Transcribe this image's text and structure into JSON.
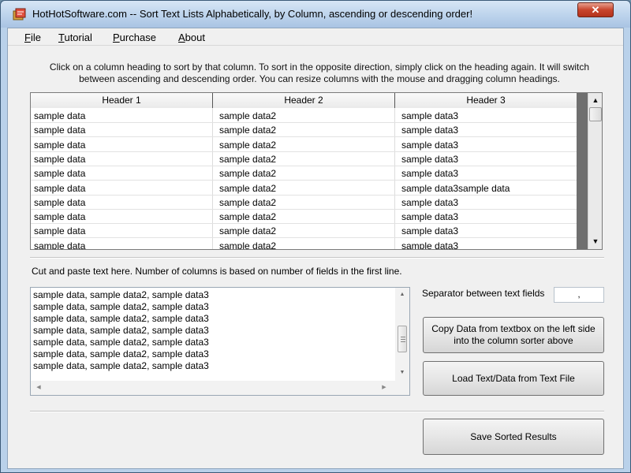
{
  "window": {
    "title": "HotHotSoftware.com -- Sort Text Lists Alphabetically, by Column, ascending or descending order!",
    "close_glyph": "✕"
  },
  "menu": {
    "items": [
      {
        "label": "File",
        "accel": "F",
        "rest": "ile"
      },
      {
        "label": "Tutorial",
        "accel": "T",
        "rest": "utorial"
      },
      {
        "label": "Purchase",
        "accel": "P",
        "rest": "urchase"
      },
      {
        "label": "About",
        "accel": "A",
        "rest": "bout"
      }
    ]
  },
  "instructions": {
    "line1": "Click on a column heading to sort by that column. To sort in the opposite direction, simply click on the heading again. It will switch",
    "line2": "between ascending and descending order. You can resize columns with the mouse and dragging column headings."
  },
  "table": {
    "headers": [
      "Header 1",
      "Header 2",
      "Header 3"
    ],
    "rows": [
      [
        "sample data",
        "sample data2",
        "sample data3"
      ],
      [
        "sample data",
        "sample data2",
        "sample data3"
      ],
      [
        "sample data",
        "sample data2",
        "sample data3"
      ],
      [
        "sample data",
        "sample data2",
        "sample data3"
      ],
      [
        "sample data",
        "sample data2",
        "sample data3"
      ],
      [
        "sample data",
        "sample data2",
        "sample data3sample data"
      ],
      [
        "sample data",
        "sample data2",
        "sample data3"
      ],
      [
        "sample data",
        "sample data2",
        "sample data3"
      ],
      [
        "sample data",
        "sample data2",
        "sample data3"
      ],
      [
        "sample data",
        "sample data2",
        "sample data3"
      ]
    ],
    "scroll_up": "▲",
    "scroll_down": "▼"
  },
  "paste": {
    "label": "Cut and paste text here. Number of columns is based on number of fields in the first line.",
    "lines": [
      "sample data, sample data2, sample data3",
      "sample data, sample data2, sample data3",
      "sample data, sample data2, sample data3",
      "sample data, sample data2, sample data3",
      "sample data, sample data2, sample data3",
      "sample data, sample data2, sample data3",
      "sample data, sample data2, sample data3"
    ],
    "scroll_up": "▲",
    "scroll_down": "▼",
    "scroll_left": "◀",
    "scroll_right": "▶"
  },
  "separator": {
    "label": "Separator between text fields",
    "value": ","
  },
  "buttons": {
    "copy_line1": "Copy Data from textbox on the left side",
    "copy_line2": "into the column sorter above",
    "load": "Load Text/Data from Text File",
    "save": "Save Sorted Results"
  }
}
